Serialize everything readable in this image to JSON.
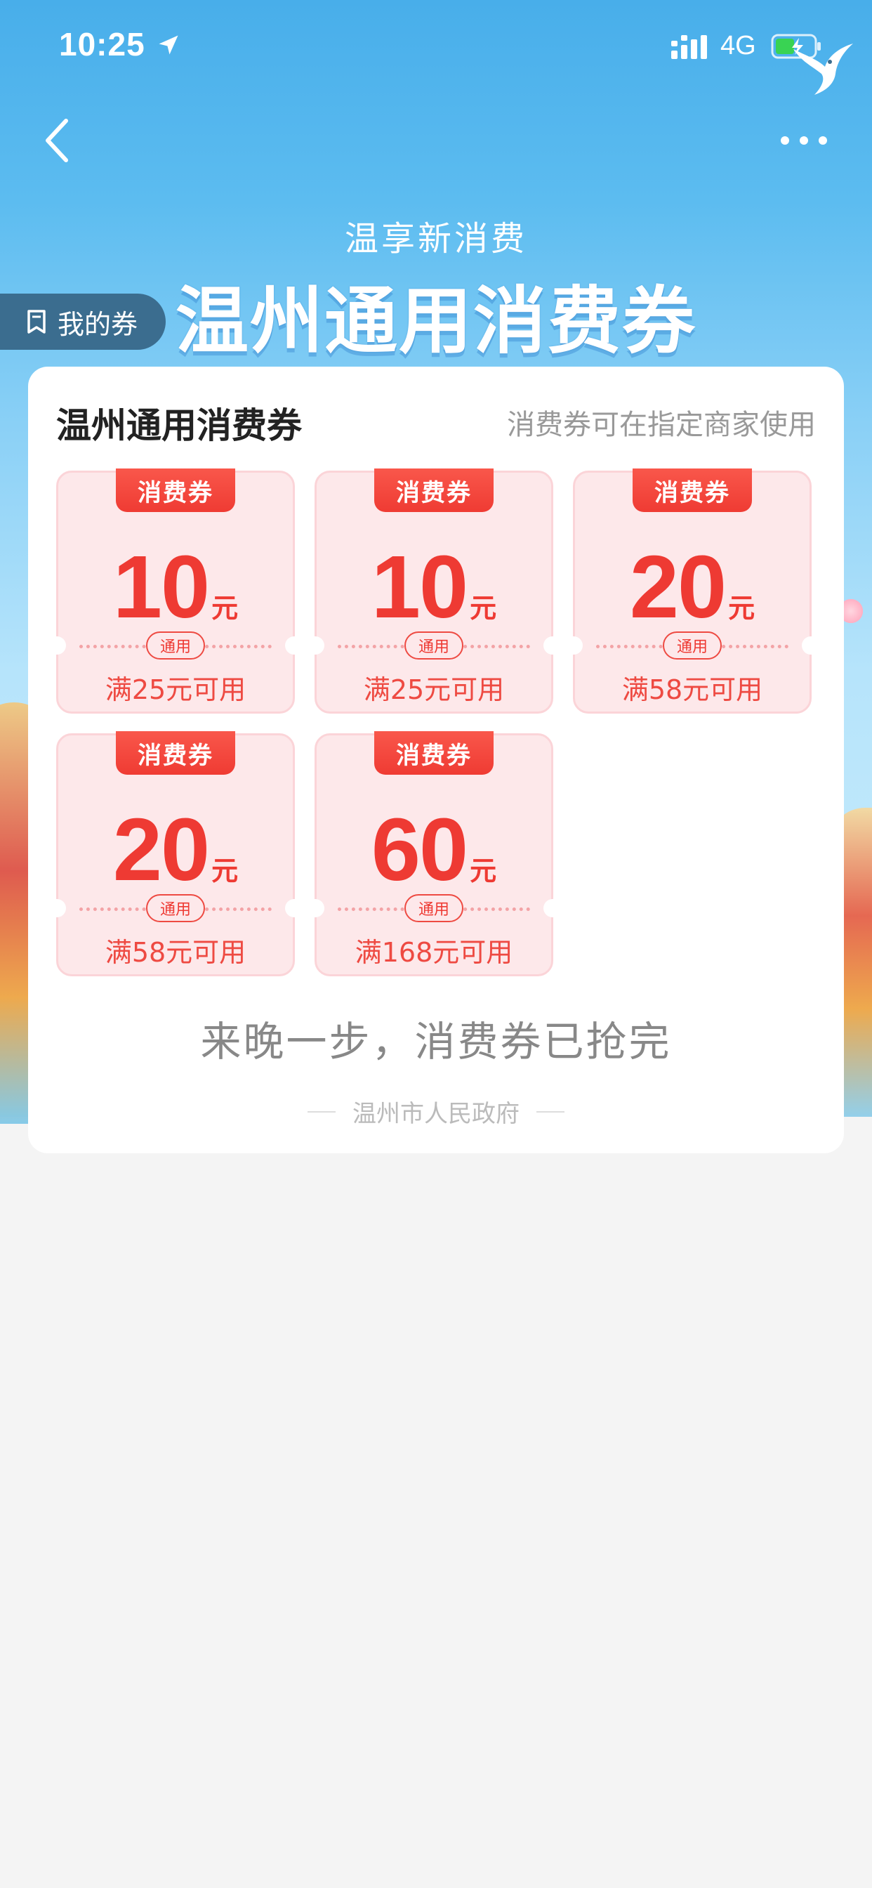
{
  "status_bar": {
    "time": "10:25",
    "network": "4G",
    "icons": [
      "location-arrow-icon",
      "signal-icon",
      "battery-charging-icon",
      "swallow-logo-icon"
    ]
  },
  "nav": {
    "back_icon": "chevron-left-icon",
    "more_icon": "more-dots-icon"
  },
  "hero": {
    "subtitle": "温享新消费",
    "title": "温州通用消费券",
    "my_coupons_label": "我的券",
    "my_coupons_icon": "ticket-icon"
  },
  "card": {
    "title": "温州通用消费券",
    "subtitle": "消费券可在指定商家使用",
    "coupons": [
      {
        "tag": "消费券",
        "amount": "10",
        "unit": "元",
        "badge": "通用",
        "condition": "满25元可用"
      },
      {
        "tag": "消费券",
        "amount": "10",
        "unit": "元",
        "badge": "通用",
        "condition": "满25元可用"
      },
      {
        "tag": "消费券",
        "amount": "20",
        "unit": "元",
        "badge": "通用",
        "condition": "满58元可用"
      },
      {
        "tag": "消费券",
        "amount": "20",
        "unit": "元",
        "badge": "通用",
        "condition": "满58元可用"
      },
      {
        "tag": "消费券",
        "amount": "60",
        "unit": "元",
        "badge": "通用",
        "condition": "满168元可用"
      }
    ],
    "soldout_message": "来晚一步，消费券已抢完",
    "footer": "温州市人民政府"
  },
  "colors": {
    "accent_red": "#ee3a33",
    "coupon_bg": "#fde8ea",
    "hero_blue": "#48aeea",
    "badge_dark": "#3b6d8f"
  }
}
